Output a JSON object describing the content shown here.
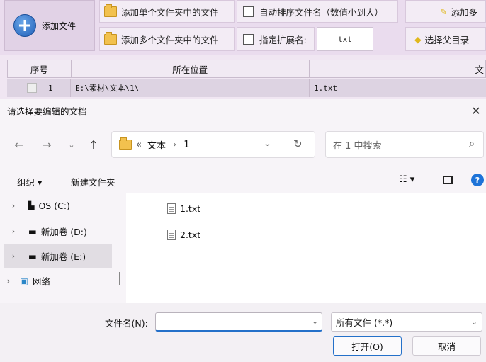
{
  "toolbar": {
    "add_file": "添加文件",
    "add_single_folder": "添加单个文件夹中的文件",
    "add_multi_folder": "添加多个文件夹中的文件",
    "auto_sort": "自动排序文件名（数值小到大）",
    "specify_ext": "指定扩展名:",
    "ext_value": "txt",
    "add_more": "添加多",
    "select_parent": "选择父目录"
  },
  "grid": {
    "headers": [
      "序号",
      "所在位置",
      "文"
    ],
    "row": {
      "index": "1",
      "location": "E:\\素材\\文本\\1\\",
      "name": "1.txt"
    }
  },
  "dialog": {
    "title": "请选择要编辑的文档",
    "breadcrumb_prefix": "«",
    "breadcrumb": [
      "文本",
      "1"
    ],
    "search_placeholder": "在 1 中搜索",
    "organize": "组织 ▾",
    "new_folder": "新建文件夹",
    "sidebar": [
      {
        "label": "OS (C:)"
      },
      {
        "label": "新加卷 (D:)"
      },
      {
        "label": "新加卷 (E:)"
      },
      {
        "label": "网络"
      }
    ],
    "files": [
      "1.txt",
      "2.txt"
    ],
    "filename_label": "文件名(N):",
    "filename_value": "",
    "filetype": "所有文件 (*.*)",
    "open_button": "打开(O)",
    "cancel_button": "取消"
  },
  "colors": {
    "accent": "#2470c9",
    "help": "#1e73d8",
    "selected": "#e1dde3"
  }
}
